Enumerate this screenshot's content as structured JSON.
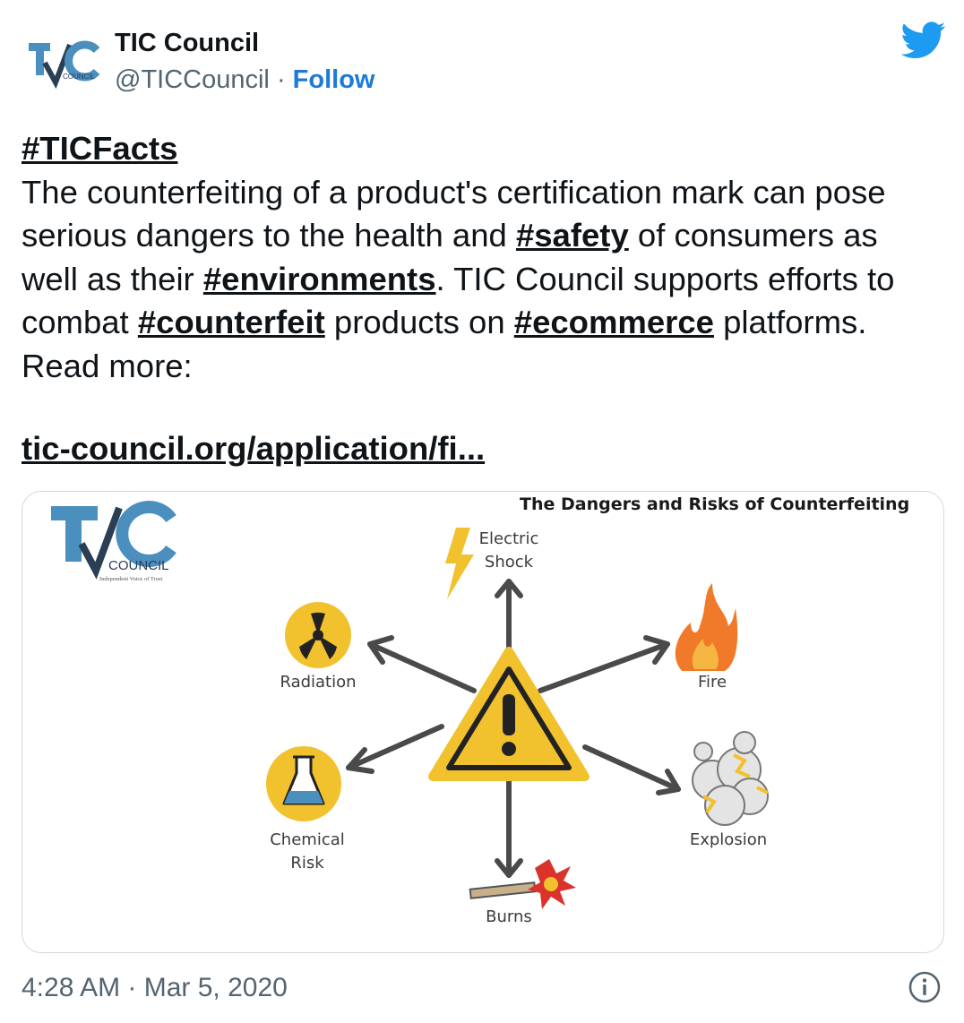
{
  "author": {
    "name": "TIC Council",
    "handle": "@TICCouncil",
    "separator": "·",
    "follow_label": "Follow",
    "avatar_icon": "tic-council-logo-icon"
  },
  "platform_icon": "twitter-bird-icon",
  "tweet": {
    "hashtag_heading": "#TICFacts",
    "text_1": "The counterfeiting of a product's certification mark can pose serious dangers to the health and ",
    "tag_safety": "#safety",
    "text_2": " of consumers as well as their ",
    "tag_environments": "#environments",
    "text_3": ". TIC Council supports efforts to combat ",
    "tag_counterfeit": "#counterfeit",
    "text_4": " products on ",
    "tag_ecommerce": "#ecommerce",
    "text_5": " platforms. Read more:",
    "link": "tic-council.org/application/fi..."
  },
  "image": {
    "title": "The Dangers and Risks of Counterfeiting",
    "logo": {
      "letters": "TIC",
      "word": "COUNCIL",
      "tagline": "Independent Voice of Trust"
    },
    "hazards": {
      "electric_line1": "Electric",
      "electric_line2": "Shock",
      "fire": "Fire",
      "explosion": "Explosion",
      "burns": "Burns",
      "chemical_line1": "Chemical",
      "chemical_line2": "Risk",
      "radiation": "Radiation"
    },
    "colors": {
      "warning_yellow": "#f2c12e",
      "logo_blue": "#4b8fbf",
      "logo_navy": "#2a3f55",
      "arrow_gray": "#4a4a4a",
      "fire_orange": "#f07a2a"
    }
  },
  "footer": {
    "timestamp": "4:28 AM · Mar 5, 2020",
    "info_icon": "info-icon"
  }
}
